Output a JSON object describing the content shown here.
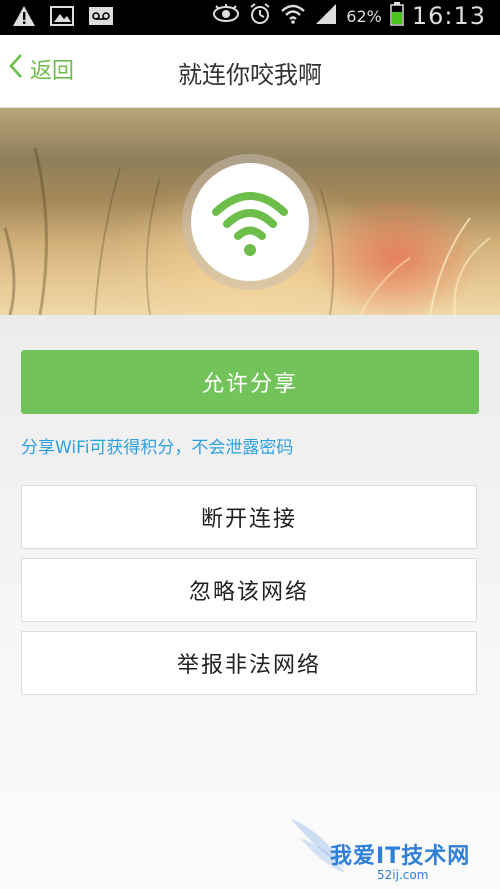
{
  "status_bar": {
    "battery_percent": "62%",
    "time": "16:13",
    "icons": [
      "warning-icon",
      "image-icon",
      "voicemail-icon",
      "eye-icon",
      "alarm-icon",
      "wifi-icon",
      "signal-icon",
      "battery-icon"
    ]
  },
  "nav": {
    "back_label": "返回",
    "title": "就连你咬我啊"
  },
  "hero": {
    "icon": "wifi-icon",
    "accent_color": "#6dbd4a"
  },
  "actions": {
    "allow_share_label": "允许分享",
    "share_hint": "分享WiFi可获得积分，不会泄露密码",
    "disconnect_label": "断开连接",
    "ignore_label": "忽略该网络",
    "report_label": "举报非法网络"
  },
  "watermark": {
    "text": "我爱IT技术网",
    "sub": "52ij.com"
  }
}
